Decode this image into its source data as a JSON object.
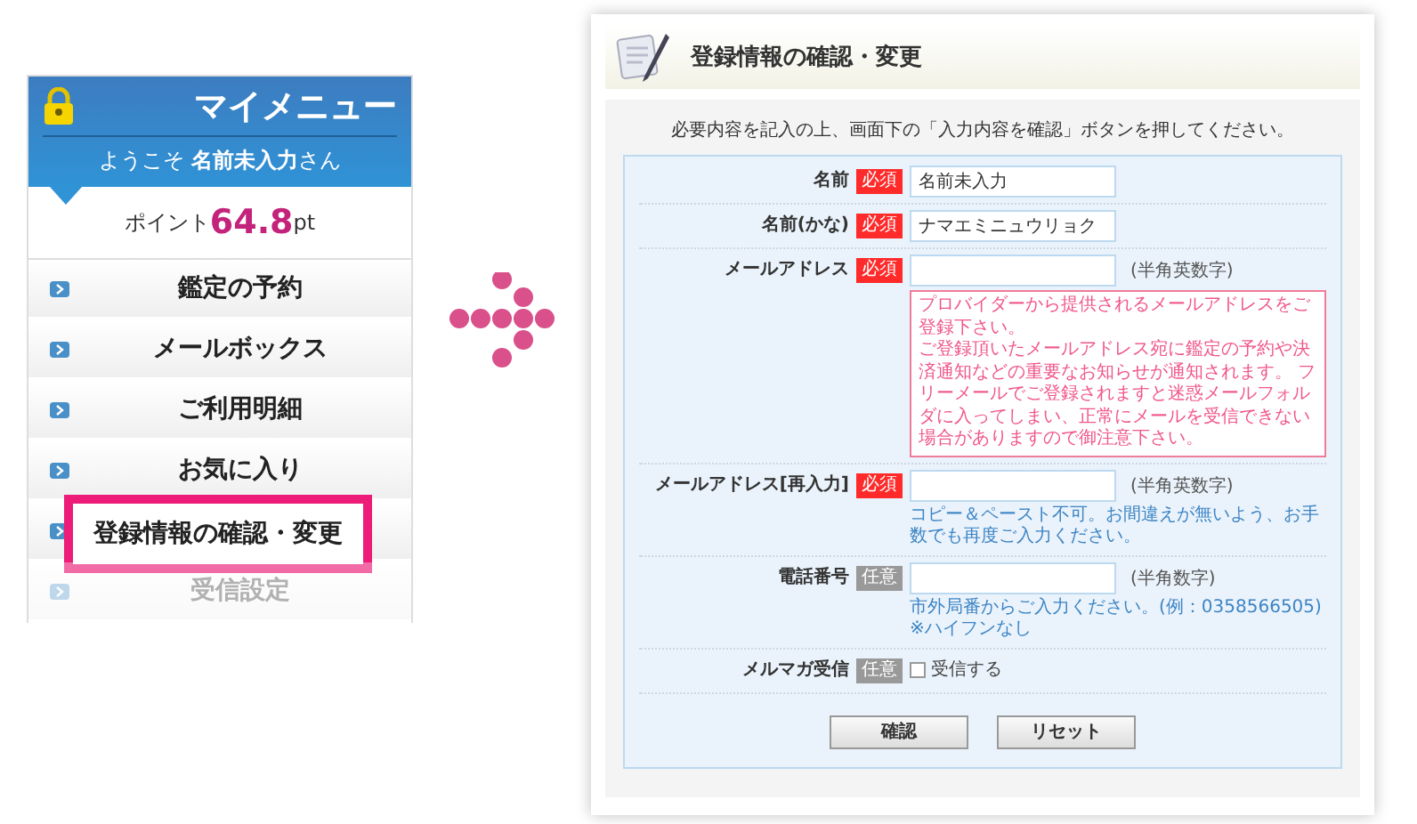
{
  "menu": {
    "title": "マイメニュー",
    "welcome": {
      "prefix": "ようこそ",
      "name": "名前未入力",
      "suffix": "さん"
    },
    "points": {
      "label": "ポイント",
      "value": "64.8",
      "unit": "pt"
    },
    "items": [
      {
        "label": "鑑定の予約",
        "highlighted": false,
        "faded": false
      },
      {
        "label": "メールボックス",
        "highlighted": false,
        "faded": false
      },
      {
        "label": "ご利用明細",
        "highlighted": false,
        "faded": false
      },
      {
        "label": "お気に入り",
        "highlighted": false,
        "faded": false
      },
      {
        "label": "登録情報の確認・変更",
        "highlighted": true,
        "faded": false
      },
      {
        "label": "受信設定",
        "highlighted": false,
        "faded": true
      }
    ]
  },
  "form": {
    "title": "登録情報の確認・変更",
    "instruction": "必要内容を記入の上、画面下の「入力内容を確認」ボタンを押してください。",
    "fields": [
      {
        "kind": "text",
        "label": "名前",
        "badge": "必須",
        "required": true,
        "value": "名前未入力"
      },
      {
        "kind": "text",
        "label": "名前(かな)",
        "badge": "必須",
        "required": true,
        "value": "ナマエミニュウリョク"
      },
      {
        "kind": "text",
        "label": "メールアドレス",
        "badge": "必須",
        "required": true,
        "unit": "(半角英数字)",
        "notice": [
          "プロバイダーから提供されるメールアドレスをご登録下さい。",
          "ご登録頂いたメールアドレス宛に鑑定の予約や決済通知などの重要なお知らせが通知されます。 フリーメールでご登録されますと迷惑メールフォルダに入ってしまい、正常にメールを受信できない場合がありますので御注意下さい。"
        ]
      },
      {
        "kind": "text",
        "label": "メールアドレス[再入力]",
        "badge": "必須",
        "required": true,
        "unit": "(半角英数字)",
        "note": "コピー＆ペースト不可。お間違えが無いよう、お手数でも再度ご入力ください。"
      },
      {
        "kind": "text",
        "label": "電話番号",
        "badge": "任意",
        "required": false,
        "unit": "(半角数字)",
        "note": "市外局番からご入力ください。(例：0358566505) ※ハイフンなし"
      },
      {
        "kind": "checkbox",
        "label": "メルマガ受信",
        "badge": "任意",
        "required": false,
        "checked": false,
        "option": "受信する"
      }
    ],
    "buttons": [
      "確認",
      "リセット"
    ]
  }
}
